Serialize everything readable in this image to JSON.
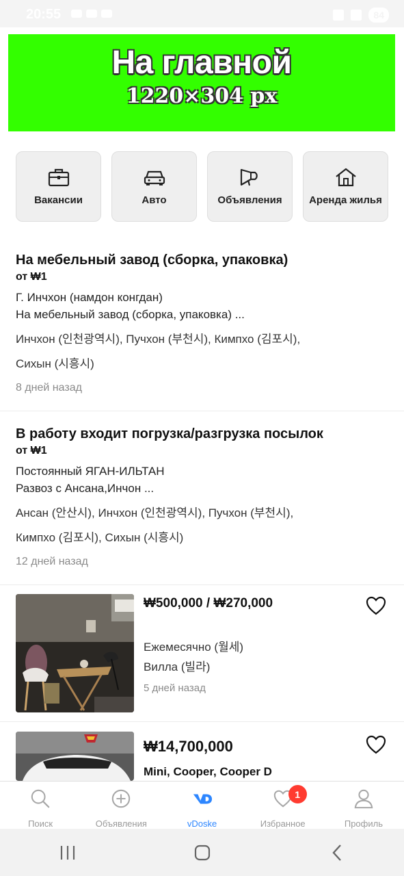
{
  "status_bar": {
    "time": "20:55",
    "battery": "84"
  },
  "banner": {
    "title": "На главной",
    "subtitle": "1220×304 px",
    "color": "#33ff00"
  },
  "categories": [
    {
      "label": "Вакансии",
      "icon": "briefcase-icon"
    },
    {
      "label": "Авто",
      "icon": "car-icon"
    },
    {
      "label": "Объявления",
      "icon": "megaphone-icon"
    },
    {
      "label": "Аренда жилья",
      "icon": "house-icon"
    }
  ],
  "posts": [
    {
      "title": "На мебельный завод (сборка, упаковка)",
      "price": "от ₩1",
      "desc1": "Г. Инчхон (намдон конгдан)",
      "desc2": "На мебельный завод (сборка, упаковка) ...",
      "loc1": "Инчхон (인천광역시), Пучхон (부천시), Кимпхо (김포시),",
      "loc2": "Сихын (시흥시)",
      "time": "8 дней назад"
    },
    {
      "title": "В работу входит погрузка/разгрузка посылок",
      "price": "от ₩1",
      "desc1": "Постоянный ЯГАН-ИЛЬТАН",
      "desc2": "Развоз с Ансана,Инчон ...",
      "loc1": "Ансан (안산시), Инчхон (인천광역시), Пучхон (부천시),",
      "loc2": "Кимпхо (김포시), Сихын (시흥시)",
      "time": "12 дней назад"
    }
  ],
  "listings": [
    {
      "price": "₩500,000 / ₩270,000",
      "payment": "Ежемесячно (월세)",
      "type": "Вилла (빌라)",
      "time": "5 дней назад"
    },
    {
      "price": "₩14,700,000",
      "title": "Mini, Cooper, Cooper D"
    }
  ],
  "bottom_nav": [
    {
      "label": "Поиск",
      "icon": "search-icon"
    },
    {
      "label": "Объявления",
      "icon": "plus-circle-icon"
    },
    {
      "label": "vDoske",
      "icon": "vdoske-logo-icon",
      "active": true
    },
    {
      "label": "Избранное",
      "icon": "heart-icon",
      "badge": "1"
    },
    {
      "label": "Профиль",
      "icon": "person-icon"
    }
  ],
  "colors": {
    "accent": "#2d86ff",
    "badge": "#ff3b30"
  }
}
